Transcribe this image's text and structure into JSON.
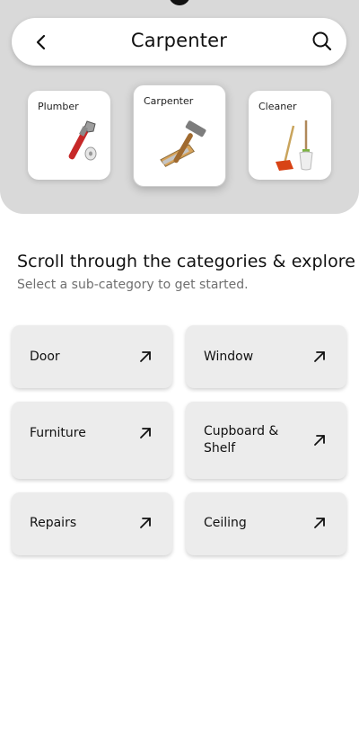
{
  "header": {
    "title": "Carpenter",
    "back_icon": "chevron-left-icon",
    "search_icon": "search-icon"
  },
  "categories": [
    {
      "label": "Plumber",
      "icon": "wrench-icon"
    },
    {
      "label": "Carpenter",
      "icon": "hammer-saw-icon",
      "selected": true
    },
    {
      "label": "Cleaner",
      "icon": "broom-mop-icon"
    }
  ],
  "intro": {
    "title": "Scroll through the categories & explore",
    "subtitle": "Select a sub-category to get started."
  },
  "subcategories": [
    {
      "label": "Door"
    },
    {
      "label": "Window"
    },
    {
      "label": "Furniture"
    },
    {
      "label": "Cupboard &\nShelf"
    },
    {
      "label": "Repairs"
    },
    {
      "label": "Ceiling"
    }
  ],
  "colors": {
    "panel": "#d9d9d9",
    "card": "#ffffff",
    "subcard": "#ececec",
    "subtitle": "#6f6f6f"
  }
}
